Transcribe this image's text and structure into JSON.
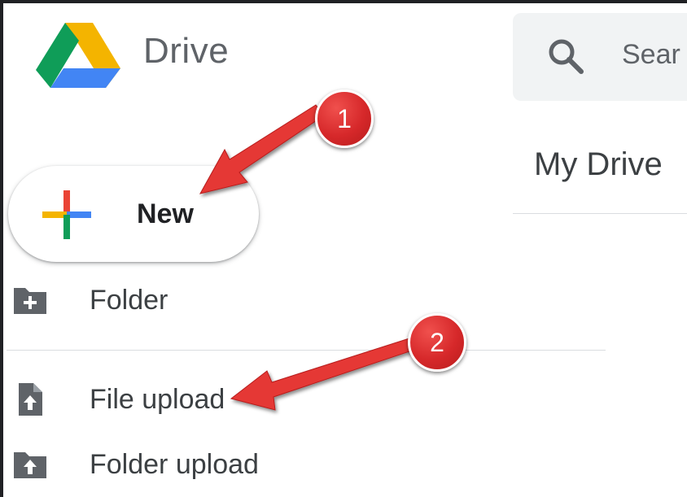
{
  "app": {
    "name": "Drive"
  },
  "search": {
    "placeholder": "Sear"
  },
  "main": {
    "title": "My Drive"
  },
  "new_button": {
    "label": "New"
  },
  "menu": {
    "items": [
      {
        "label": "Folder",
        "icon": "folder-plus-icon"
      },
      {
        "label": "File upload",
        "icon": "file-upload-icon"
      },
      {
        "label": "Folder upload",
        "icon": "folder-upload-icon"
      }
    ]
  },
  "annotations": {
    "markers": [
      "1",
      "2"
    ],
    "color": "#d32f2f"
  },
  "colors": {
    "drive_green": "#0f9d58",
    "drive_yellow": "#f4b400",
    "drive_blue": "#4285f4",
    "plus_red": "#ea4335",
    "icon_gray": "#5f6368"
  }
}
